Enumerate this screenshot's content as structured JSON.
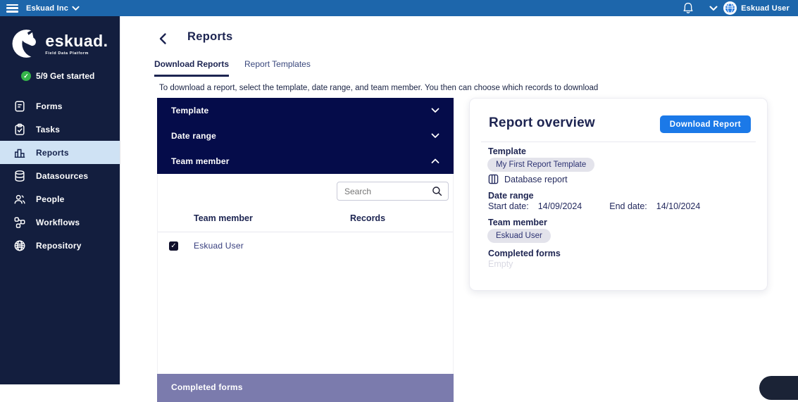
{
  "topbar": {
    "org_name": "Eskuad Inc",
    "user_name": "Eskuad User"
  },
  "sidebar": {
    "logo_word": "eskuad.",
    "logo_tagline": "Field Data Platform",
    "get_started": "5/9 Get started",
    "get_started_check": "✓",
    "items": [
      {
        "label": "Forms",
        "active": false
      },
      {
        "label": "Tasks",
        "active": false
      },
      {
        "label": "Reports",
        "active": true
      },
      {
        "label": "Datasources",
        "active": false
      },
      {
        "label": "People",
        "active": false
      },
      {
        "label": "Workflows",
        "active": false
      },
      {
        "label": "Repository",
        "active": false
      }
    ]
  },
  "header": {
    "title": "Reports"
  },
  "tabs": [
    {
      "label": "Download Reports",
      "active": true
    },
    {
      "label": "Report Templates",
      "active": false
    }
  ],
  "description": "To download a report, select the template, date range, and team member. You then can choose which records to download",
  "filters": {
    "sections": [
      {
        "label": "Template",
        "expanded": false
      },
      {
        "label": "Date range",
        "expanded": false
      },
      {
        "label": "Team member",
        "expanded": true
      }
    ],
    "search_placeholder": "Search",
    "table": {
      "columns": [
        "Team member",
        "Records"
      ],
      "rows": [
        {
          "name": "Eskuad User",
          "checked": true,
          "checkmark": "✓"
        }
      ]
    },
    "bottom_section": "Completed forms"
  },
  "overview": {
    "title": "Report overview",
    "download_button": "Download Report",
    "template_label": "Template",
    "template_chip": "My First Report Template",
    "template_type": "Database report",
    "date_range_label": "Date range",
    "start_date_label": "Start date:",
    "start_date": "14/09/2024",
    "end_date_label": "End date:",
    "end_date": "14/10/2024",
    "team_member_label": "Team member",
    "team_member_chip": "Eskuad User",
    "completed_forms_label": "Completed forms",
    "completed_forms_value": "Empty"
  },
  "colors": {
    "topbar_blue": "#1d66ab",
    "sidebar_navy": "#131e3e",
    "accordion_navy": "#050c4a",
    "active_item_bg": "#cfe2f4",
    "accent_blue": "#1b79e8",
    "navy_text": "#1d2451",
    "chip_bg": "#e3e3eb",
    "bottom_bar_purple": "#7b7bad",
    "success_green": "#35b44a"
  }
}
